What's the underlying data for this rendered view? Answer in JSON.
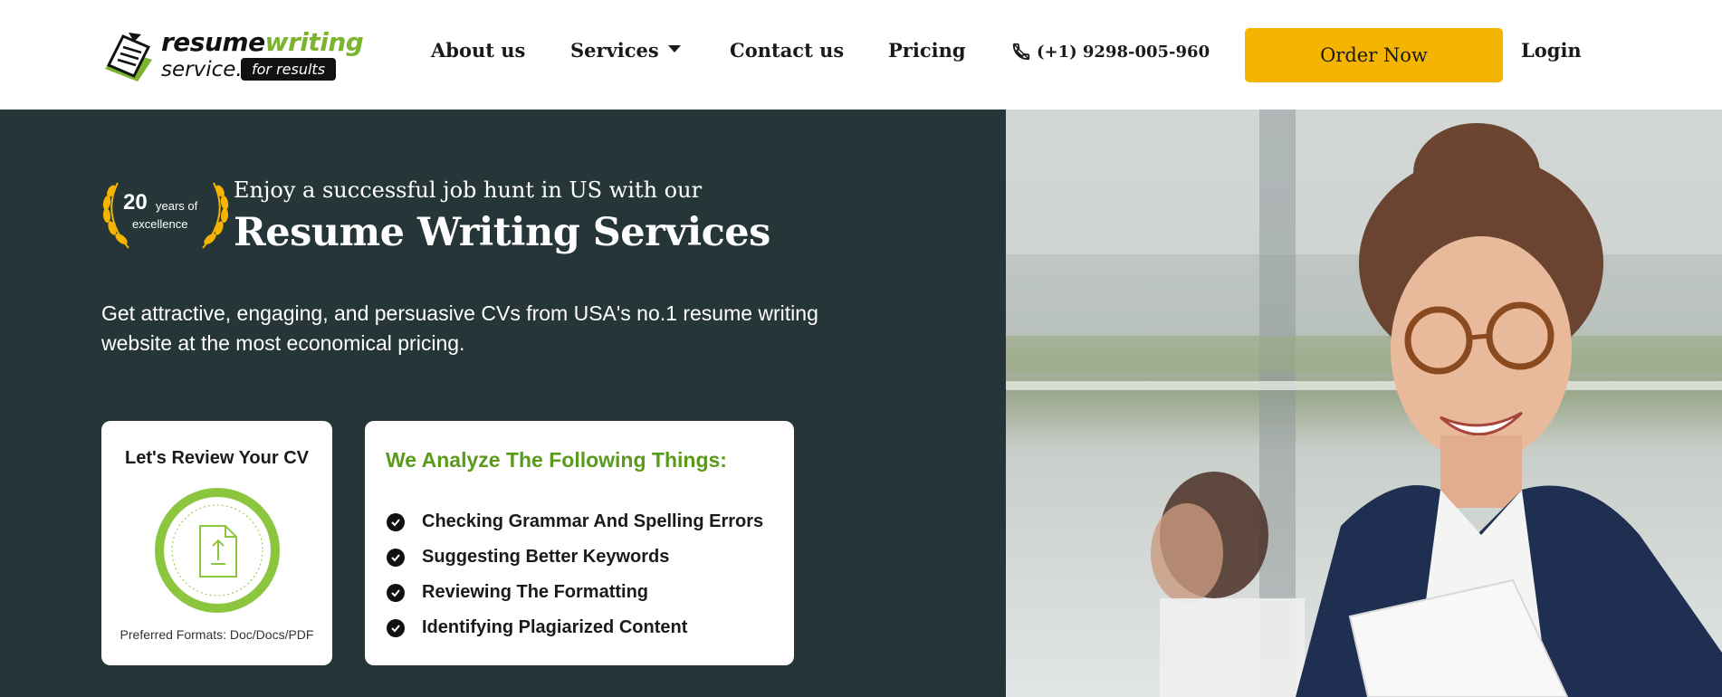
{
  "brand": {
    "word1_a": "resume",
    "word1_b": "writing",
    "word2": "service.",
    "tag": "for results",
    "accent_green": "#7cb430",
    "accent_yellow": "#f5b400"
  },
  "nav": {
    "about": "About us",
    "services": "Services",
    "contact": "Contact us",
    "pricing": "Pricing",
    "phone": "(+1) 9298-005-960",
    "order": "Order Now",
    "login": "Login"
  },
  "hero": {
    "badge_num": "20",
    "badge_years": "years of",
    "badge_exc": "excellence",
    "tagline": "Enjoy a successful job hunt in US with our",
    "title": "Resume Writing Services",
    "description": "Get attractive, engaging, and persuasive CVs from USA's no.1 resume writing website at the most economical pricing.",
    "bg_color": "#263638"
  },
  "review_card": {
    "title": "Let's Review Your CV",
    "formats": "Preferred Formats: Doc/Docs/PDF",
    "icon": "upload-document-icon"
  },
  "analyze_card": {
    "title": "We Analyze The Following Things:",
    "items": [
      "Checking Grammar And Spelling Errors",
      "Suggesting Better Keywords",
      "Reviewing The Formatting",
      "Identifying Plagiarized Content"
    ]
  }
}
